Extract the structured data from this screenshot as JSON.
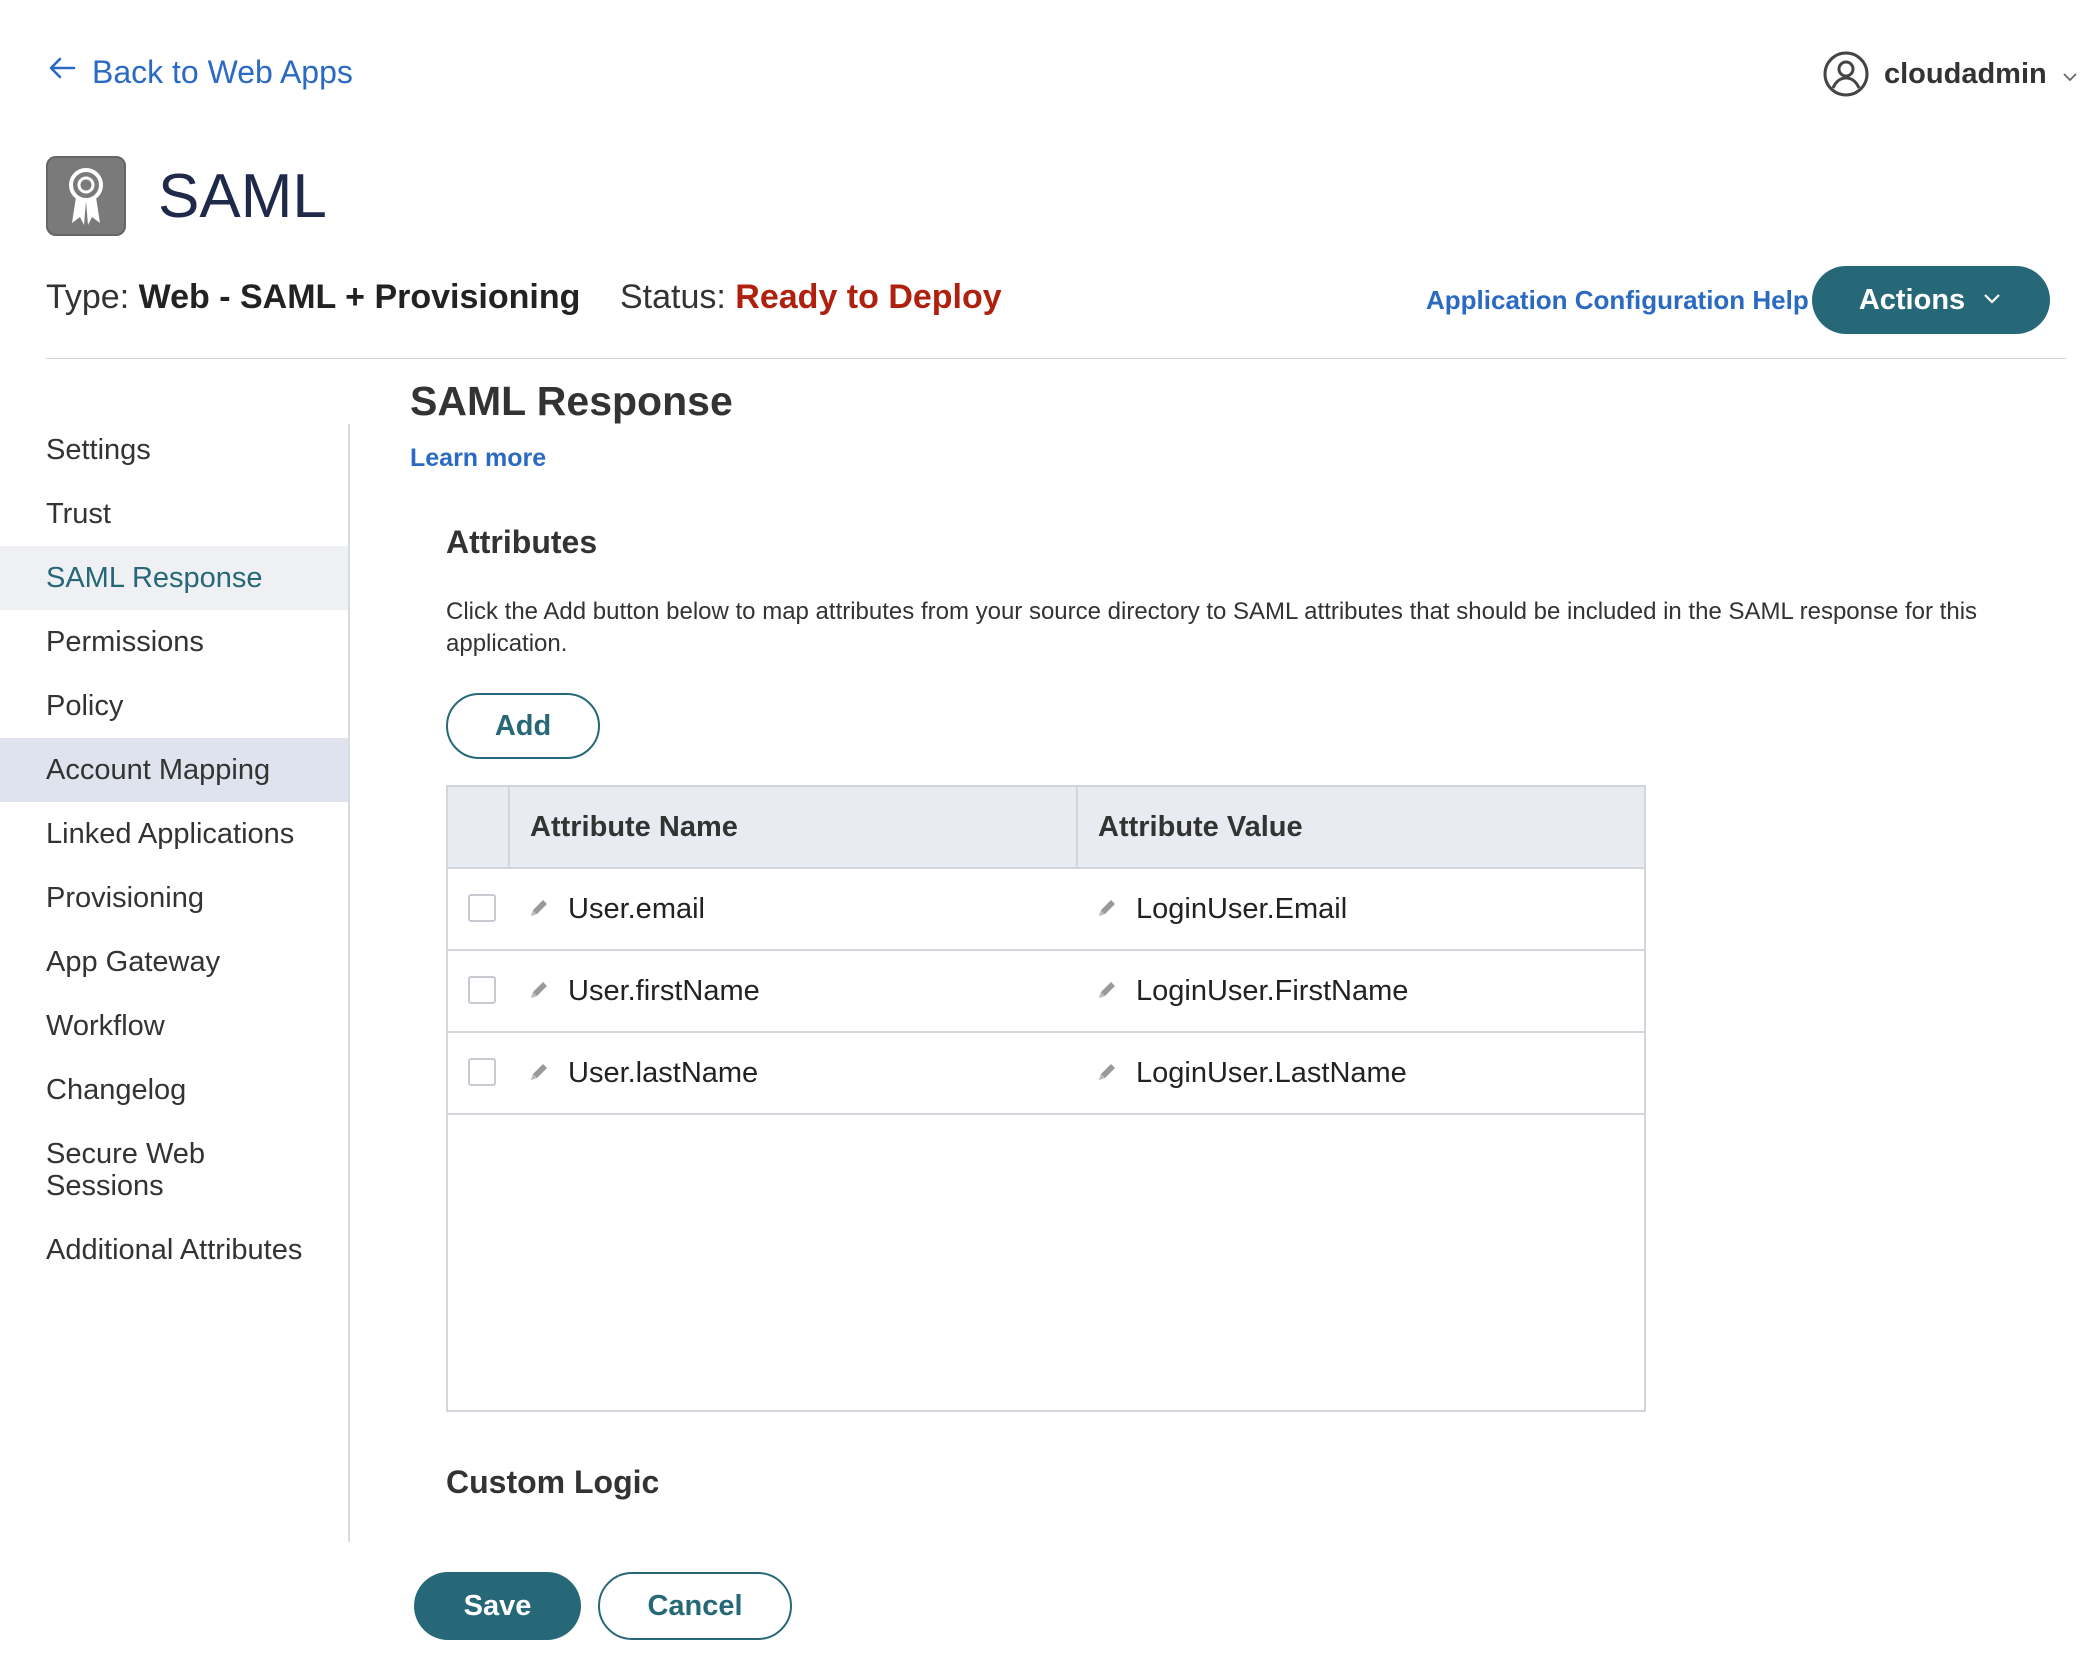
{
  "nav": {
    "back_label": "Back to Web Apps",
    "back_icon": "arrow-left-icon",
    "user_name": "cloudadmin"
  },
  "app": {
    "title": "SAML",
    "icon": "certificate-ribbon-icon",
    "type_label": "Type:",
    "type_value": "Web - SAML + Provisioning",
    "status_label": "Status:",
    "status_value": "Ready to Deploy",
    "status_color": "#b0200e"
  },
  "header": {
    "help_link": "Application Configuration Help",
    "actions_label": "Actions"
  },
  "sidebar": {
    "items": [
      {
        "label": "Settings"
      },
      {
        "label": "Trust"
      },
      {
        "label": "SAML Response"
      },
      {
        "label": "Permissions"
      },
      {
        "label": "Policy"
      },
      {
        "label": "Account Mapping"
      },
      {
        "label": "Linked Applications"
      },
      {
        "label": "Provisioning"
      },
      {
        "label": "App Gateway"
      },
      {
        "label": "Workflow"
      },
      {
        "label": "Changelog"
      },
      {
        "label": "Secure Web Sessions"
      },
      {
        "label": "Additional Attributes"
      }
    ],
    "active": "SAML Response"
  },
  "main": {
    "section_title": "SAML Response",
    "learn_more": "Learn more",
    "attributes_heading": "Attributes",
    "attributes_description": "Click the Add button below to map attributes from your source directory to SAML attributes that should be included in the SAML response for this application.",
    "add_label": "Add",
    "table": {
      "columns": [
        "Attribute Name",
        "Attribute Value"
      ],
      "rows": [
        {
          "name": "User.email",
          "value": "LoginUser.Email"
        },
        {
          "name": "User.firstName",
          "value": "LoginUser.FirstName"
        },
        {
          "name": "User.lastName",
          "value": "LoginUser.LastName"
        }
      ]
    },
    "custom_logic_heading": "Custom Logic"
  },
  "footer": {
    "save_label": "Save",
    "cancel_label": "Cancel"
  },
  "colors": {
    "accent": "#276878",
    "link": "#2b6ac3",
    "title": "#1f2a4a"
  }
}
